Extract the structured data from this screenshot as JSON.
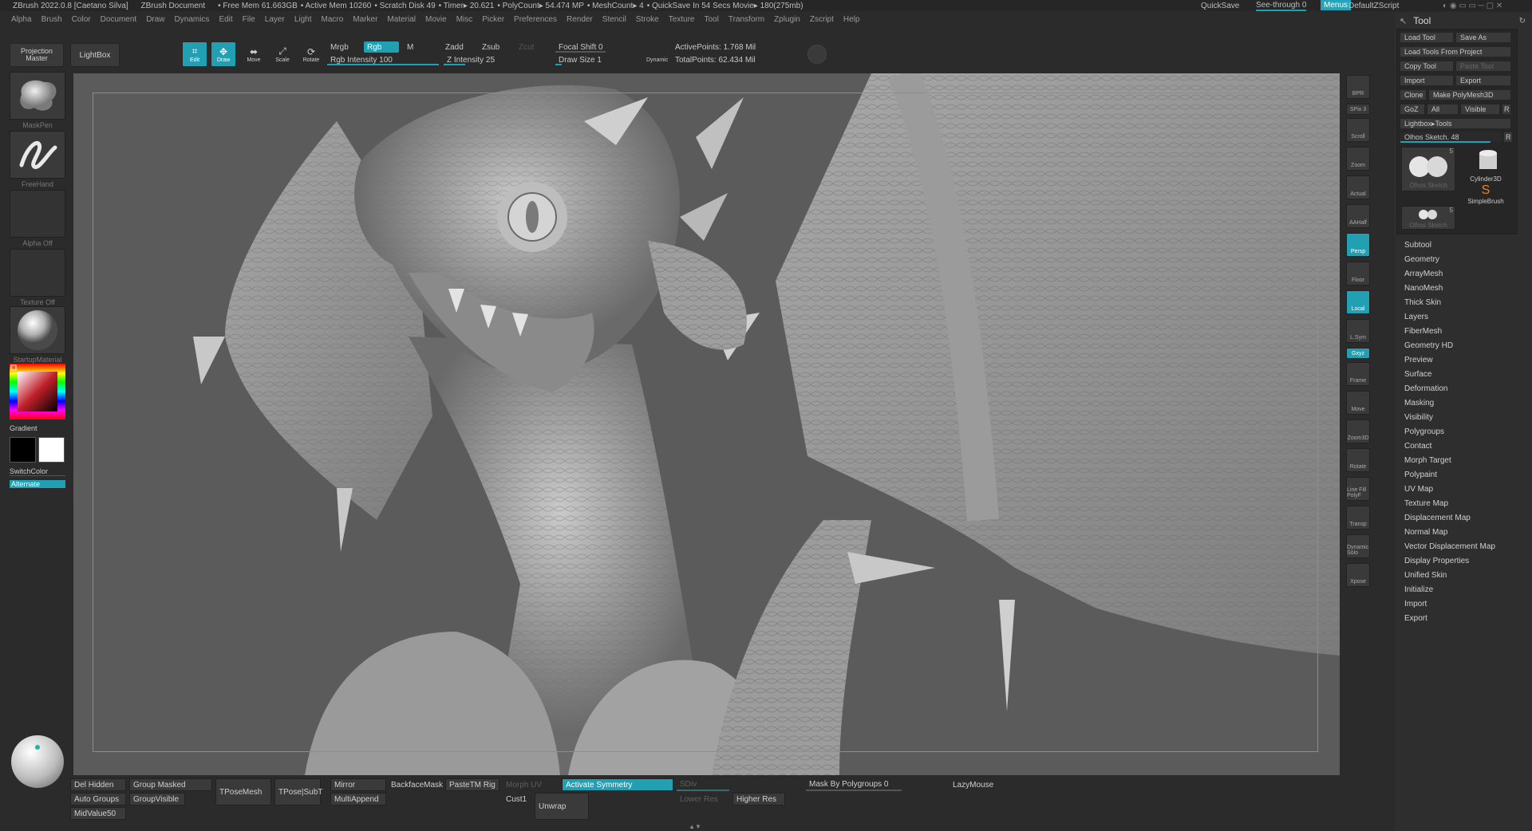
{
  "titlebar": {
    "app": "ZBrush 2022.0.8 [Caetano Silva]",
    "document": "ZBrush Document",
    "free_mem": "• Free Mem 61.663GB",
    "active_mem": "• Active Mem 10260",
    "scratch": "• Scratch Disk 49",
    "timer": "• Timer▸ 20.621",
    "polycount": "• PolyCount▸ 54.474 MP",
    "meshcount": "• MeshCount▸ 4",
    "quicksave_status": "• QuickSave In 54 Secs Movie▸ 180(275mb)",
    "quicksave_btn": "QuickSave",
    "see_through": "See-through  0",
    "menus": "Menus",
    "default_zscript": "DefaultZScript"
  },
  "menubar": [
    "Alpha",
    "Brush",
    "Color",
    "Document",
    "Draw",
    "Dynamics",
    "Edit",
    "File",
    "Layer",
    "Light",
    "Macro",
    "Marker",
    "Material",
    "Movie",
    "Misc",
    "Picker",
    "Preferences",
    "Render",
    "Stencil",
    "Stroke",
    "Texture",
    "Tool",
    "Transform",
    "Zplugin",
    "Zscript",
    "Help"
  ],
  "top_toolbar": {
    "projection_master": "Projection Master",
    "lightbox": "LightBox",
    "edit": "Edit",
    "draw": "Draw",
    "move": "Move",
    "scale": "Scale",
    "rotate": "Rotate",
    "mrgb": "Mrgb",
    "rgb": "Rgb",
    "m": "M",
    "rgb_intensity": "Rgb Intensity 100",
    "zadd": "Zadd",
    "zsub": "Zsub",
    "zcut": "Zcut",
    "z_intensity": "Z Intensity 25",
    "focal_shift": "Focal Shift 0",
    "draw_size": "Draw Size 1",
    "dynamic": "Dynamic",
    "active_points": "ActivePoints: 1.768 Mil",
    "total_points": "TotalPoints: 62.434 Mil"
  },
  "left_shelf": {
    "brush": "MaskPen",
    "stroke": "FreeHand",
    "alpha": "Alpha Off",
    "texture": "Texture Off",
    "material": "StartupMaterial",
    "gradient": "Gradient",
    "switch_color": "SwitchColor",
    "alternate": "Alternate"
  },
  "right_shelf": [
    "BPR",
    "SPix 3",
    "Scroll",
    "Zoom",
    "Actual",
    "AAHalf",
    "Persp",
    "Floor",
    "Local",
    "L.Sym",
    "Gxyz",
    "Frame",
    "Move",
    "Zoom3D",
    "Rotate",
    "Line Fill PolyF",
    "Transp",
    "Dynamic Solo",
    "Xpose"
  ],
  "tool_palette": {
    "title": "Tool",
    "load_tool": "Load Tool",
    "save_as": "Save As",
    "load_from_project": "Load Tools From Project",
    "copy_tool": "Copy Tool",
    "paste_tool": "Paste Tool",
    "import": "Import",
    "export": "Export",
    "clone": "Clone",
    "make_polymesh": "Make PolyMesh3D",
    "goz": "GoZ",
    "all": "All",
    "visible": "Visible",
    "r": "R",
    "lightbox_tools": "Lightbox▸Tools",
    "current_tool": "Olhos Sketch. 48",
    "thumbs": [
      "Olhos Sketch",
      "Cylinder3D",
      "SimpleBrush",
      "Olhos Sketch"
    ],
    "thumb_counts": [
      "5",
      "5"
    ],
    "subpalettes": [
      "Subtool",
      "Geometry",
      "ArrayMesh",
      "NanoMesh",
      "Thick Skin",
      "Layers",
      "FiberMesh",
      "Geometry HD",
      "Preview",
      "Surface",
      "Deformation",
      "Masking",
      "Visibility",
      "Polygroups",
      "Contact",
      "Morph Target",
      "Polypaint",
      "UV Map",
      "Texture Map",
      "Displacement Map",
      "Normal Map",
      "Vector Displacement Map",
      "Display Properties",
      "Unified Skin",
      "Initialize",
      "Import",
      "Export"
    ]
  },
  "bottom_shelf": {
    "del_hidden": "Del Hidden",
    "group_masked": "Group Masked",
    "tposemesh": "TPoseMesh",
    "tpose_subt": "TPose|SubT",
    "mirror": "Mirror",
    "backface_mask": "BackfaceMask",
    "pastetm_rig": "PasteTM Rig",
    "morph_uv": "Morph UV",
    "activate_symmetry": "Activate Symmetry",
    "sdiv": "SDiv",
    "mask_by_polygroups": "Mask By Polygroups 0",
    "lazymouse": "LazyMouse",
    "auto_groups": "Auto Groups",
    "group_visible": "GroupVisible",
    "multi_append": "MultiAppend",
    "cust1": "Cust1",
    "unwrap": "Unwrap",
    "lower_res": "Lower Res",
    "higher_res": "Higher Res",
    "mid_value": "MidValue50"
  },
  "colors": {
    "accent": "#21a0b3",
    "bg": "#2b2b2b",
    "viewport": "#5b5b5b"
  }
}
